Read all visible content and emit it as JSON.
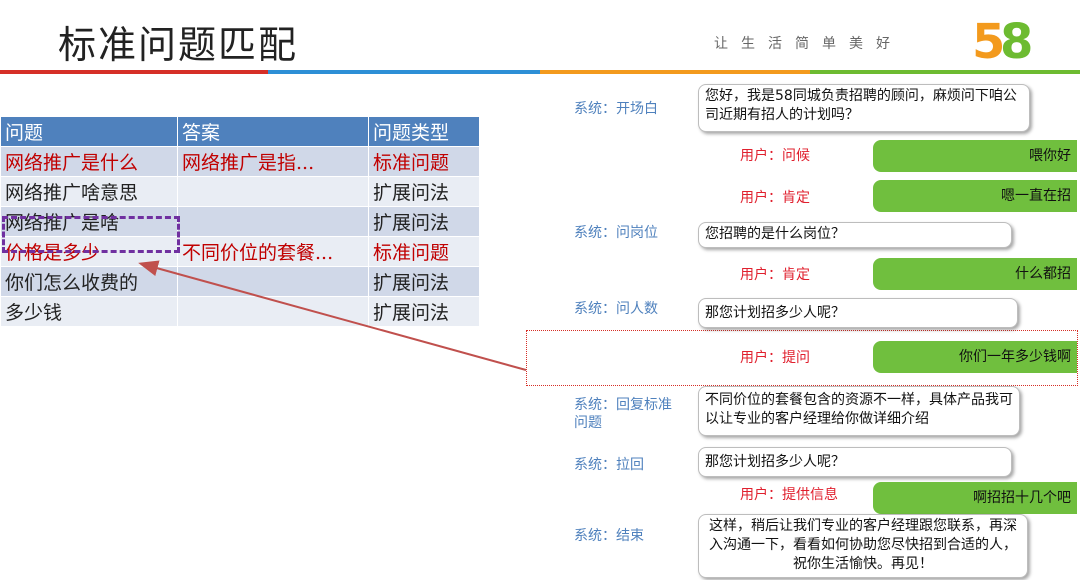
{
  "header": {
    "title": "标准问题匹配",
    "slogan": "让生活简单美好",
    "logo_text": "58",
    "rule_colors": [
      "#d62f27",
      "#2d8fd6",
      "#f39a1d",
      "#6dbb31"
    ]
  },
  "table": {
    "headers": [
      "问题",
      "答案",
      "问题类型"
    ],
    "rows": [
      {
        "question": "网络推广是什么",
        "answer": "网络推广是指...",
        "type": "标准问题"
      },
      {
        "question": "网络推广啥意思",
        "answer": "",
        "type": "扩展问法"
      },
      {
        "question": "网络推广是啥",
        "answer": "",
        "type": "扩展问法"
      },
      {
        "question": "价格是多少",
        "answer": "不同价位的套餐...",
        "type": "标准问题"
      },
      {
        "question": "你们怎么收费的",
        "answer": "",
        "type": "扩展问法"
      },
      {
        "question": "多少钱",
        "answer": "",
        "type": "扩展问法"
      }
    ]
  },
  "dialog": {
    "sys_open_label": "系统：开场白",
    "sys_open_text": "您好，我是58同城负责招聘的顾问，麻烦问下咱公司近期有招人的计划吗？",
    "user_greet_label": "用户：问候",
    "user_greet_text": "喂你好",
    "user_yes1_label": "用户：肯定",
    "user_yes1_text": "嗯一直在招",
    "sys_pos_label": "系统：问岗位",
    "sys_pos_text": "您招聘的是什么岗位？",
    "user_yes2_label": "用户：肯定",
    "user_yes2_text": "什么都招",
    "sys_count_label": "系统：问人数",
    "sys_count_text": "那您计划招多少人呢？",
    "user_ask_label": "用户：提问",
    "user_ask_text": "你们一年多少钱啊",
    "sys_reply_label": "系统：回复标准问题",
    "sys_reply_text": "不同价位的套餐包含的资源不一样，具体产品我可以让专业的客户经理给你做详细介绍",
    "sys_back_label": "系统：拉回",
    "sys_back_text": "那您计划招多少人呢？",
    "user_info_label": "用户：提供信息",
    "user_info_text": "啊招招十几个吧",
    "sys_end_label": "系统：结束",
    "sys_end_text": "这样，稍后让我们专业的客户经理跟您联系，再深入沟通一下，看看如何协助您尽快招到合适的人，祝你生活愉快。再见！"
  }
}
